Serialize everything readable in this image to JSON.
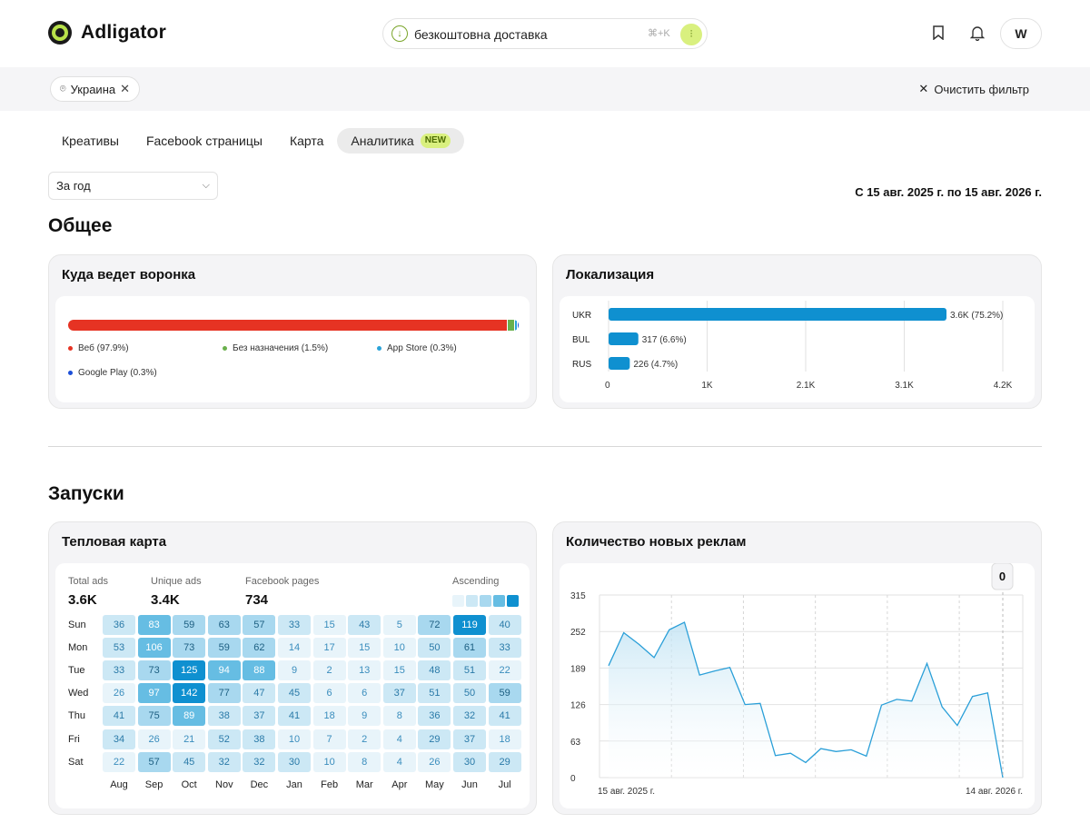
{
  "header": {
    "logo_text": "Adligator",
    "search": {
      "value": "безкоштовна доставка",
      "shortcut": "⌘+K"
    },
    "avatar_letter": "W"
  },
  "filter_bar": {
    "chip_label": "Украина",
    "clear_label": "Очистить фильтр"
  },
  "tabs": [
    {
      "label": "Креативы"
    },
    {
      "label": "Facebook страницы"
    },
    {
      "label": "Карта"
    },
    {
      "label": "Аналитика",
      "badge": "NEW",
      "active": true
    }
  ],
  "period": {
    "selected": "За год"
  },
  "date_range": "С 15 авг. 2025 г. по 15 авг. 2026 г.",
  "sections": {
    "general": "Общее",
    "launches": "Запуски"
  },
  "funnel": {
    "title": "Куда ведет воронка",
    "legend": [
      {
        "label": "Веб (97.9%)",
        "color": "#e63323",
        "share": 97.9
      },
      {
        "label": "Без назначения (1.5%)",
        "color": "#6ab04c",
        "share": 1.5
      },
      {
        "label": "App Store (0.3%)",
        "color": "#2aa3d8",
        "share": 0.3
      },
      {
        "label": "Google Play (0.3%)",
        "color": "#1c4fd8",
        "share": 0.3
      }
    ]
  },
  "localization": {
    "title": "Локализация",
    "chart_data": {
      "type": "bar",
      "orientation": "horizontal",
      "categories": [
        "UKR",
        "BUL",
        "RUS"
      ],
      "values": [
        3600,
        317,
        226
      ],
      "data_labels": [
        "3.6K (75.2%)",
        "317 (6.6%)",
        "226 (4.7%)"
      ],
      "x_ticks": [
        "0",
        "1K",
        "2.1K",
        "3.1K",
        "4.2K"
      ],
      "xlim": [
        0,
        4200
      ],
      "bar_color": "#0f90d0",
      "grid": true
    }
  },
  "heatmap": {
    "title": "Тепловая карта",
    "stats": [
      {
        "label": "Total ads",
        "value": "3.6K"
      },
      {
        "label": "Unique ads",
        "value": "3.4K"
      },
      {
        "label": "Facebook pages",
        "value": "734"
      }
    ],
    "scale_label": "Ascending",
    "chart_data": {
      "type": "heatmap",
      "rows": [
        "Sun",
        "Mon",
        "Tue",
        "Wed",
        "Thu",
        "Fri",
        "Sat"
      ],
      "columns": [
        "Aug",
        "Sep",
        "Oct",
        "Nov",
        "Dec",
        "Jan",
        "Feb",
        "Mar",
        "Apr",
        "May",
        "Jun",
        "Jul"
      ],
      "values": [
        [
          36,
          83,
          59,
          63,
          57,
          33,
          15,
          43,
          5,
          72,
          119,
          40
        ],
        [
          53,
          106,
          73,
          59,
          62,
          14,
          17,
          15,
          10,
          50,
          61,
          33
        ],
        [
          33,
          73,
          125,
          94,
          88,
          9,
          2,
          13,
          15,
          48,
          51,
          22
        ],
        [
          26,
          97,
          142,
          77,
          47,
          45,
          6,
          6,
          37,
          51,
          50,
          59
        ],
        [
          41,
          75,
          89,
          38,
          37,
          41,
          18,
          9,
          8,
          36,
          32,
          41
        ],
        [
          34,
          26,
          21,
          52,
          38,
          10,
          7,
          2,
          4,
          29,
          37,
          18
        ],
        [
          22,
          57,
          45,
          32,
          32,
          30,
          10,
          8,
          4,
          26,
          30,
          29
        ]
      ]
    }
  },
  "new_ads": {
    "title": "Количество новых реклам",
    "tooltip_value": "0",
    "chart_data": {
      "type": "area",
      "y_ticks": [
        "0",
        "63",
        "126",
        "189",
        "252",
        "315"
      ],
      "ylim": [
        0,
        315
      ],
      "x_start_label": "15 авг. 2025 г.",
      "x_end_label": "14 авг. 2026 г.",
      "series": [
        {
          "values": [
            193,
            250,
            230,
            207,
            255,
            268,
            177,
            184,
            190,
            126,
            128,
            38,
            42,
            26,
            50,
            45,
            48,
            37,
            125,
            135,
            132,
            197,
            122,
            90,
            140,
            146,
            0
          ]
        }
      ],
      "line_color": "#2a9fd8"
    }
  }
}
